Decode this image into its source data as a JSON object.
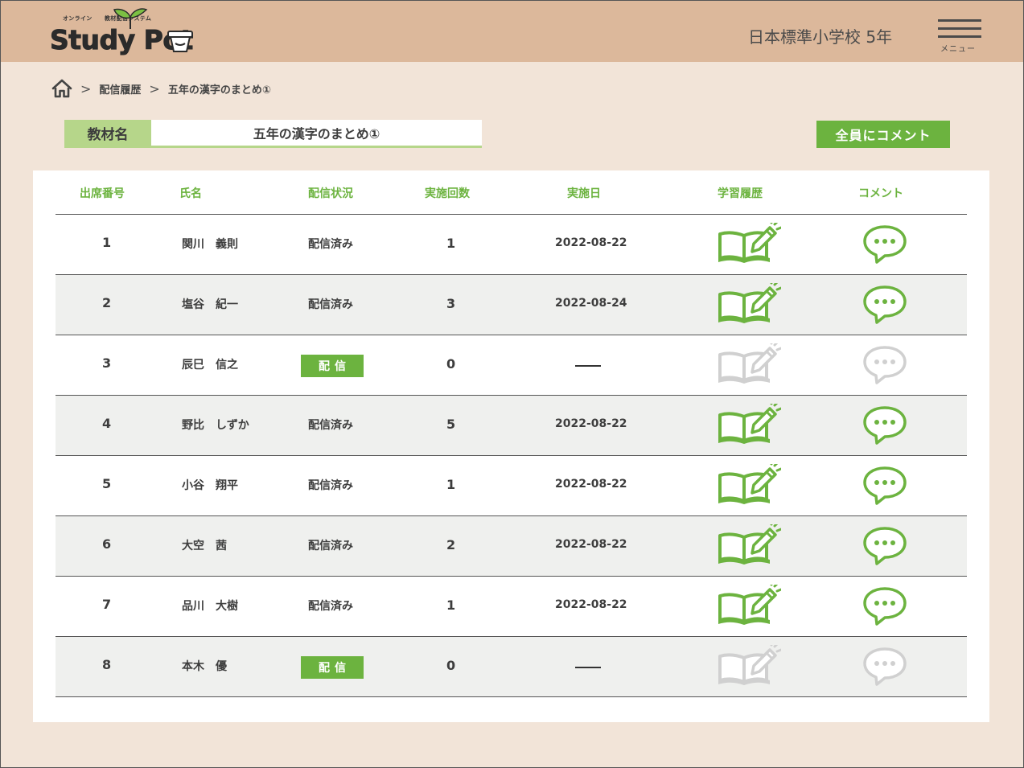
{
  "header": {
    "logo": {
      "small_left": "オンライン",
      "small_right": "教材配信システム",
      "main": "Study Pot"
    },
    "school": "日本標準小学校  5年",
    "menu_label": "メニュー",
    "icons": {
      "menu": "hamburger-icon",
      "logo": "sprout-pot-icon"
    }
  },
  "breadcrumb": {
    "items": [
      "配信履歴",
      "五年の漢字のまとめ①"
    ],
    "separator": ">",
    "home_icon": "home-icon"
  },
  "material": {
    "label": "教材名",
    "value": "五年の漢字のまとめ①"
  },
  "comment_all_label": "全員にコメント",
  "table": {
    "headers": [
      "出席番号",
      "氏名",
      "配信状況",
      "実施回数",
      "実施日",
      "学習履歴",
      "コメント"
    ],
    "rows": [
      {
        "no": "1",
        "name": "関川　義則",
        "status": "配信済み",
        "count": "1",
        "date": "2022-08-22",
        "active": true
      },
      {
        "no": "2",
        "name": "塩谷　紀一",
        "status": "配信済み",
        "count": "3",
        "date": "2022-08-24",
        "active": true
      },
      {
        "no": "3",
        "name": "辰巳　信之",
        "status": "button",
        "count": "0",
        "date": "",
        "active": false
      },
      {
        "no": "4",
        "name": "野比　しずか",
        "status": "配信済み",
        "count": "5",
        "date": "2022-08-22",
        "active": true
      },
      {
        "no": "5",
        "name": "小谷　翔平",
        "status": "配信済み",
        "count": "1",
        "date": "2022-08-22",
        "active": true
      },
      {
        "no": "6",
        "name": "大空　茜",
        "status": "配信済み",
        "count": "2",
        "date": "2022-08-22",
        "active": true
      },
      {
        "no": "7",
        "name": "品川　大樹",
        "status": "配信済み",
        "count": "1",
        "date": "2022-08-22",
        "active": true
      },
      {
        "no": "8",
        "name": "本木　優",
        "status": "button",
        "count": "0",
        "date": "",
        "active": false
      }
    ],
    "send_button_label": "配信",
    "icons": {
      "history": "book-pencil-icon",
      "comment": "speech-bubble-icon"
    }
  },
  "colors": {
    "header_bg": "#dcb89b",
    "page_bg": "#f2e4d8",
    "accent_green": "#6cb33f",
    "label_green": "#b6d68a",
    "disabled_gray": "#d0d0d0"
  }
}
